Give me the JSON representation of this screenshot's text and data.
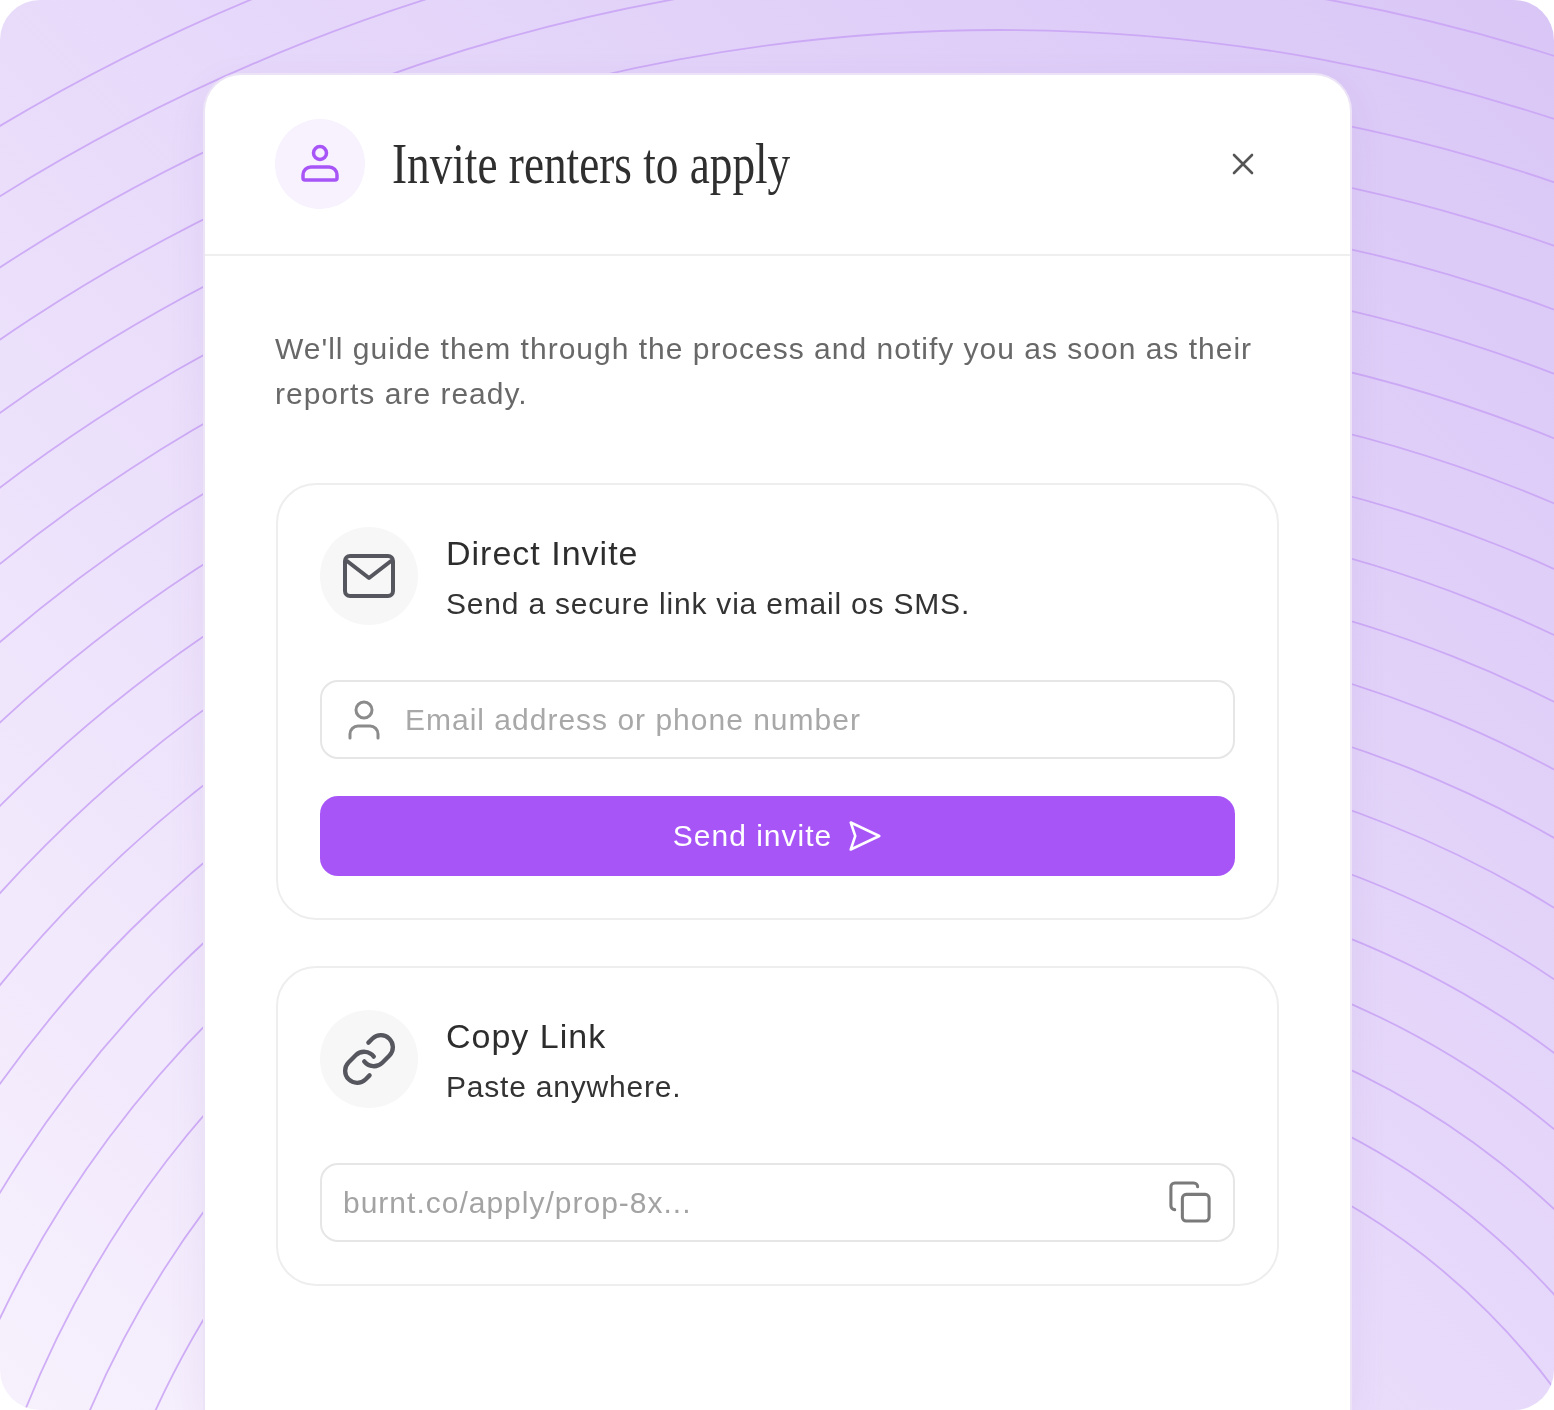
{
  "dialog": {
    "title": "Invite renters to apply",
    "description": "We'll guide them through the process and notify you as soon as their reports are ready."
  },
  "options": [
    {
      "kind": "direct_invite",
      "title": "Direct Invite",
      "subtitle": "Send a secure link via email os SMS.",
      "field": {
        "placeholder": "Email address or phone number"
      },
      "button": {
        "label": "Send invite"
      }
    },
    {
      "kind": "copy_link",
      "title": "Copy Link",
      "subtitle": "Paste anywhere.",
      "field": {
        "value": "burnt.co/apply/prop-8x..."
      }
    }
  ]
}
